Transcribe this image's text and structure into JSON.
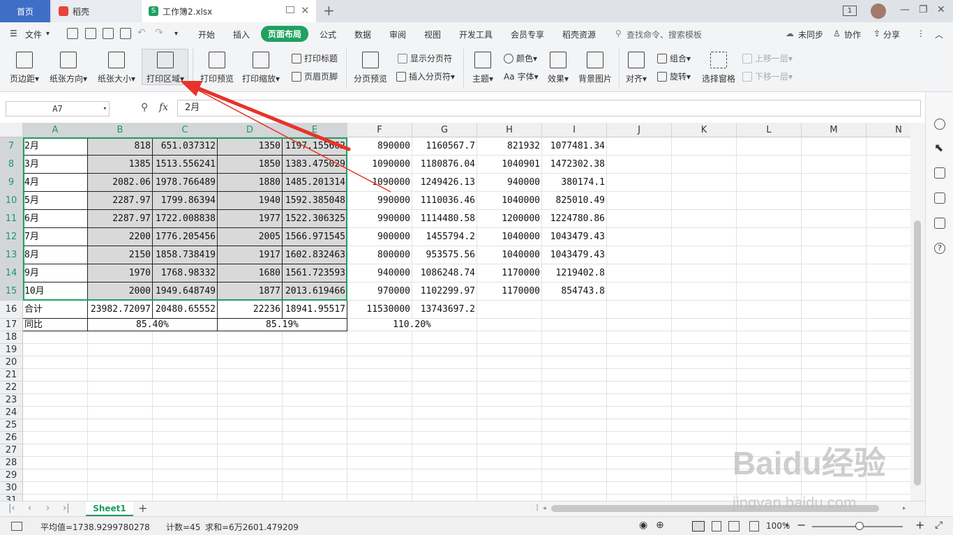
{
  "tabs": {
    "home": "首页",
    "doc1": "稻壳",
    "doc2": "工作簿2.xlsx",
    "add": "+",
    "sync_badge": "1"
  },
  "menu": {
    "file": "文件",
    "items": [
      "开始",
      "插入",
      "页面布局",
      "公式",
      "数据",
      "审阅",
      "视图",
      "开发工具",
      "会员专享",
      "稻壳资源"
    ],
    "active": "页面布局",
    "search": "查找命令、搜索模板",
    "unsync": "未同步",
    "collab": "协作",
    "share": "分享"
  },
  "ribbon": {
    "margins": "页边距",
    "orientation": "纸张方向",
    "size": "纸张大小",
    "print_area": "打印区域",
    "preview": "打印预览",
    "scale": "打印缩放",
    "print_title": "打印标题",
    "header_footer": "页眉页脚",
    "page_break_preview": "分页预览",
    "show_breaks": "显示分页符",
    "insert_break": "插入分页符",
    "theme": "主题",
    "color": "颜色",
    "font": "字体",
    "effect": "效果",
    "bg_image": "背景图片",
    "align": "对齐",
    "group": "组合",
    "rotate": "旋转",
    "select_pane": "选择窗格",
    "up_layer": "上移一层",
    "down_layer": "下移一层"
  },
  "formula": {
    "cellref": "A7",
    "fx": "fx",
    "value": "2月"
  },
  "columns": [
    "A",
    "B",
    "C",
    "D",
    "E",
    "F",
    "G",
    "H",
    "I",
    "J",
    "K",
    "L",
    "M",
    "N"
  ],
  "rows": [
    {
      "n": "7",
      "c": [
        "2月",
        "818",
        "651.037312",
        "1350",
        "1197.155662",
        "890000",
        "1160567.7",
        "821932",
        "1077481.34"
      ]
    },
    {
      "n": "8",
      "c": [
        "3月",
        "1385",
        "1513.556241",
        "1850",
        "1383.475029",
        "1090000",
        "1180876.04",
        "1040901",
        "1472302.38"
      ]
    },
    {
      "n": "9",
      "c": [
        "4月",
        "2082.06",
        "1978.766489",
        "1880",
        "1485.201314",
        "1090000",
        "1249426.13",
        "940000",
        "380174.1"
      ]
    },
    {
      "n": "10",
      "c": [
        "5月",
        "2287.97",
        "1799.86394",
        "1940",
        "1592.385048",
        "990000",
        "1110036.46",
        "1040000",
        "825010.49"
      ]
    },
    {
      "n": "11",
      "c": [
        "6月",
        "2287.97",
        "1722.008838",
        "1977",
        "1522.306325",
        "990000",
        "1114480.58",
        "1200000",
        "1224780.86"
      ]
    },
    {
      "n": "12",
      "c": [
        "7月",
        "2200",
        "1776.205456",
        "2005",
        "1566.971545",
        "900000",
        "1455794.2",
        "1040000",
        "1043479.43"
      ]
    },
    {
      "n": "13",
      "c": [
        "8月",
        "2150",
        "1858.738419",
        "1917",
        "1602.832463",
        "800000",
        "953575.56",
        "1040000",
        "1043479.43"
      ]
    },
    {
      "n": "14",
      "c": [
        "9月",
        "1970",
        "1768.98332",
        "1680",
        "1561.723593",
        "940000",
        "1086248.74",
        "1170000",
        "1219402.8"
      ]
    },
    {
      "n": "15",
      "c": [
        "10月",
        "2000",
        "1949.648749",
        "1877",
        "2013.619466",
        "970000",
        "1102299.97",
        "1170000",
        "854743.8"
      ]
    }
  ],
  "total_row": {
    "n": "16",
    "c": [
      "合计",
      "23982.72097",
      "20480.65552",
      "22236",
      "18941.95517",
      "11530000",
      "13743697.2"
    ]
  },
  "yoy_row": {
    "n": "17",
    "label": "同比",
    "v1": "85.40%",
    "v2": "85.19%",
    "v3": "110.20%"
  },
  "empty_rows": [
    "18",
    "19",
    "20",
    "21",
    "22",
    "23",
    "24",
    "25",
    "26",
    "27",
    "28",
    "29",
    "30",
    "31"
  ],
  "sheet": {
    "name": "Sheet1",
    "add": "+"
  },
  "status": {
    "avg": "平均值=1738.9299780278",
    "count": "计数=45",
    "sum": "求和=6万2601.479209",
    "zoom": "100%"
  },
  "watermark": {
    "brand": "Baidu经验",
    "url": "jingyan.baidu.com"
  }
}
